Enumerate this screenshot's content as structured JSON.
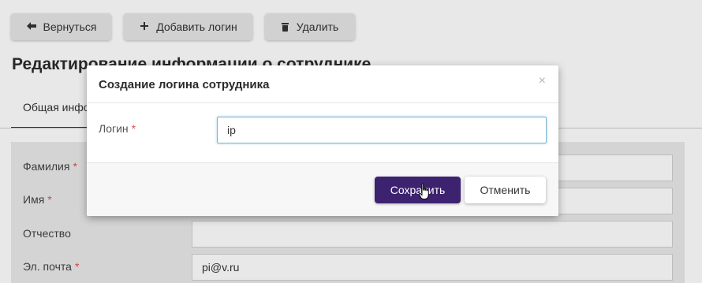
{
  "toolbar": {
    "back_label": "Вернуться",
    "back_icon": "arrow-left-icon",
    "add_login_label": "Добавить логин",
    "add_login_icon": "plus-icon",
    "delete_label": "Удалить",
    "delete_icon": "trash-icon"
  },
  "page": {
    "title": "Редактирование информации о сотруднике",
    "active_tab": "Общая информация"
  },
  "form": {
    "fields": [
      {
        "label": "Фамилия",
        "required": "*",
        "value": ""
      },
      {
        "label": "Имя",
        "required": "*",
        "value": ""
      },
      {
        "label": "Отчество",
        "required": "",
        "value": ""
      },
      {
        "label": "Эл. почта",
        "required": "*",
        "value": "pi@v.ru"
      }
    ]
  },
  "modal": {
    "title": "Создание логина сотрудника",
    "close_icon": "close-icon",
    "close_glyph": "×",
    "login_label": "Логин",
    "login_required": "*",
    "login_value": "ip",
    "save_label": "Сохранить",
    "cancel_label": "Отменить"
  },
  "colors": {
    "accent": "#3d2270",
    "required": "#d9534f",
    "input_focus_border": "#7bb6d4"
  }
}
